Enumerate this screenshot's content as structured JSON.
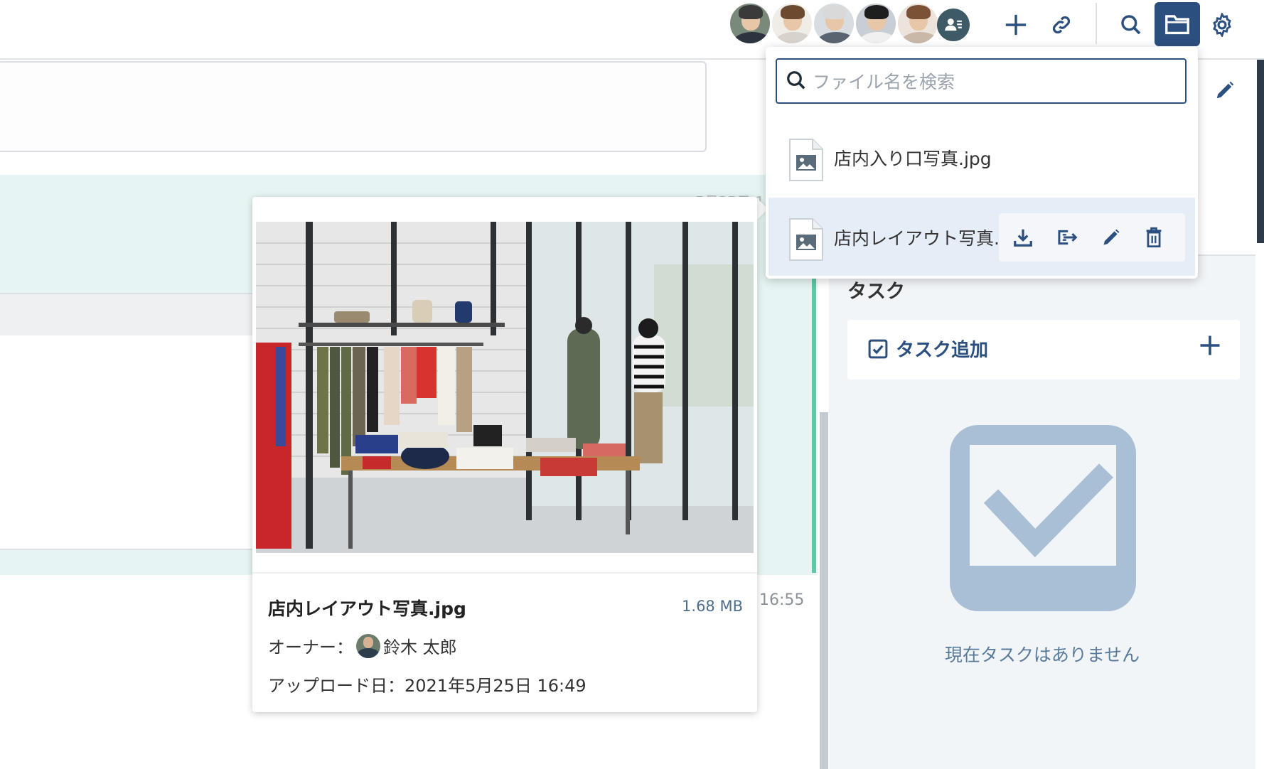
{
  "topbar": {
    "avatars": [
      {
        "name": "member-avatar-1",
        "hair": "#3a3a3a",
        "body": "#2c3440",
        "bg": "#7a8a7a"
      },
      {
        "name": "member-avatar-2",
        "hair": "#6b4a30",
        "body": "#d8d2cc",
        "bg": "#f0ece6"
      },
      {
        "name": "member-avatar-3",
        "hair": "#d9d9d9",
        "body": "#5a6470",
        "bg": "#d8dde2"
      },
      {
        "name": "member-avatar-4",
        "hair": "#1e1e1e",
        "body": "#f0f0f0",
        "bg": "#c9ced4"
      },
      {
        "name": "member-avatar-5",
        "hair": "#7a5236",
        "body": "#c9b8a8",
        "bg": "#ece4dc"
      }
    ],
    "icons": [
      "members-icon",
      "plus-icon",
      "link-icon",
      "search-icon",
      "folder-icon",
      "gear-icon"
    ],
    "active_icon": "folder-icon",
    "accent": "#2b4f7e"
  },
  "file_dropdown": {
    "search_placeholder": "ファイル名を検索",
    "files": [
      {
        "name": "店内入り口写真.jpg"
      },
      {
        "name": "店内レイアウト写真.jpg"
      }
    ],
    "hover_actions": [
      "download-icon",
      "share-icon",
      "edit-icon",
      "trash-icon"
    ]
  },
  "preview": {
    "file_name": "店内レイアウト写真.jpg",
    "file_size": "1.68 MB",
    "owner_label": "オーナー：",
    "owner_name": "鈴木 太郎",
    "upload_label": "アップロード日：2021年5月25日 16:49"
  },
  "messages": {
    "timestamp_partial": "5月25日 1",
    "timestamp": "16:55"
  },
  "tasks": {
    "title": "タスク",
    "add_label": "タスク追加",
    "empty_text": "現在タスクはありません"
  }
}
